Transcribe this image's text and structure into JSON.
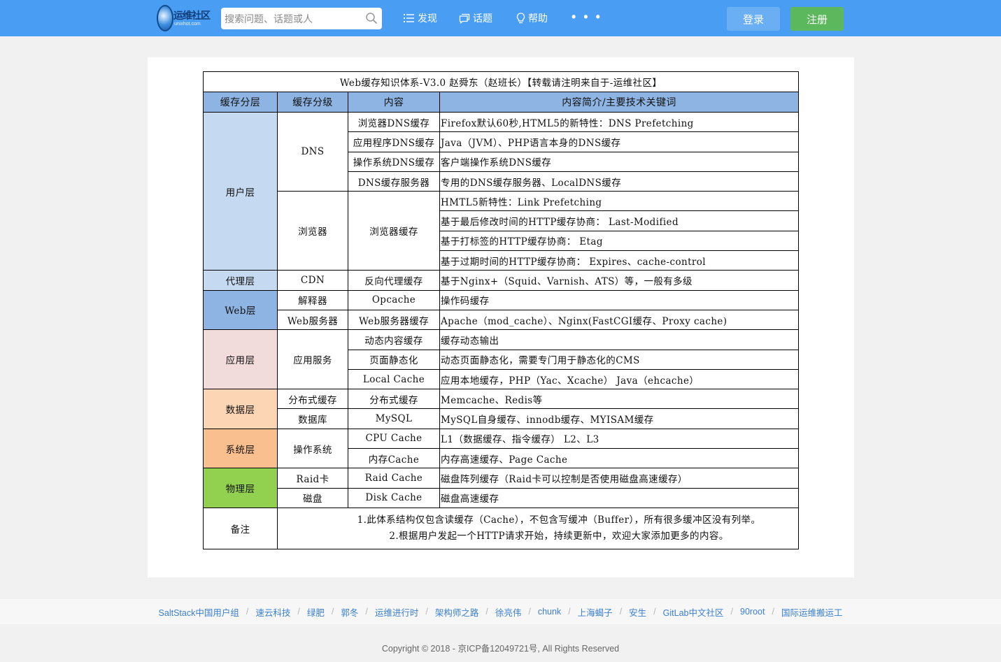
{
  "header": {
    "logo_text": "运维社区",
    "logo_sub": "unixhot.com",
    "search_placeholder": "搜索问题、话题或人",
    "nav": [
      {
        "label": "发现",
        "icon": "list-icon"
      },
      {
        "label": "话题",
        "icon": "chat-icon"
      },
      {
        "label": "帮助",
        "icon": "lightbulb-icon"
      }
    ],
    "more": "• • •",
    "login_label": "登录",
    "register_label": "注册"
  },
  "table": {
    "title": "Web缓存知识体系-V3.0 赵舜东（赵班长）【转载请注明来自于-运维社区】",
    "headers": [
      "缓存分层",
      "缓存分级",
      "内容",
      "内容简介/主要技术关键词"
    ],
    "user_layer": {
      "layer": "用户层",
      "dns": {
        "level": "DNS",
        "rows": [
          {
            "content": "浏览器DNS缓存",
            "desc": "Firefox默认60秒,HTML5的新特性：DNS Prefetching"
          },
          {
            "content": "应用程序DNS缓存",
            "desc": "Java（JVM）、PHP语言本身的DNS缓存"
          },
          {
            "content": "操作系统DNS缓存",
            "desc": "客户端操作系统DNS缓存"
          },
          {
            "content": "DNS缓存服务器",
            "desc": "专用的DNS缓存服务器、LocalDNS缓存"
          }
        ]
      },
      "browser": {
        "level": "浏览器",
        "content": "浏览器缓存",
        "descs": [
          "HMTL5新特性：Link Prefetching",
          "基于最后修改时间的HTTP缓存协商： Last-Modified",
          "基于打标签的HTTP缓存协商： Etag",
          "基于过期时间的HTTP缓存协商：  Expires、cache-control"
        ]
      }
    },
    "proxy_layer": {
      "layer": "代理层",
      "level": "CDN",
      "content": "反向代理缓存",
      "desc": "基于Nginx+（Squid、Varnish、ATS）等，一般有多级"
    },
    "web_layer": {
      "layer": "Web层",
      "rows": [
        {
          "level": "解释器",
          "content": "Opcache",
          "desc": "操作码缓存"
        },
        {
          "level": "Web服务器",
          "content": "Web服务器缓存",
          "desc": "Apache（mod_cache）、Nginx(FastCGI缓存、Proxy cache)"
        }
      ]
    },
    "app_layer": {
      "layer": "应用层",
      "level": "应用服务",
      "rows": [
        {
          "content": "动态内容缓存",
          "desc": "缓存动态输出"
        },
        {
          "content": "页面静态化",
          "desc": "动态页面静态化，需要专门用于静态化的CMS"
        },
        {
          "content": "Local Cache",
          "desc": "应用本地缓存，PHP（Yac、Xcache） Java（ehcache）"
        }
      ]
    },
    "data_layer": {
      "layer": "数据层",
      "rows": [
        {
          "level": "分布式缓存",
          "content": "分布式缓存",
          "desc": "Memcache、Redis等"
        },
        {
          "level": "数据库",
          "content": "MySQL",
          "desc": "MySQL自身缓存、innodb缓存、MYISAM缓存"
        }
      ]
    },
    "sys_layer": {
      "layer": "系统层",
      "level": "操作系统",
      "rows": [
        {
          "content": "CPU Cache",
          "desc": "L1（数据缓存、指令缓存） L2、L3"
        },
        {
          "content": "内存Cache",
          "desc": "内存高速缓存、Page Cache"
        }
      ]
    },
    "phys_layer": {
      "layer": "物理层",
      "rows": [
        {
          "level": "Raid卡",
          "content": "Raid Cache",
          "desc": "磁盘阵列缓存（Raid卡可以控制是否使用磁盘高速缓存）"
        },
        {
          "level": "磁盘",
          "content": "Disk Cache",
          "desc": "磁盘高速缓存"
        }
      ]
    },
    "note": {
      "label": "备注",
      "lines": [
        "1.此体系结构仅包含读缓存（Cache），不包含写缓冲（Buffer），所有很多缓冲区没有列举。",
        "2.根据用户发起一个HTTP请求开始，持续更新中，欢迎大家添加更多的内容。"
      ]
    }
  },
  "footer": {
    "links": [
      "SaltStack中国用户组",
      "速云科技",
      "绿肥",
      "郭冬",
      "运维进行时",
      "架构师之路",
      "徐亮伟",
      "chunk",
      "上海蝎子",
      "安生",
      "GitLab中文社区",
      "90root",
      "国际运维搬运工"
    ],
    "copyright": "Copyright © 2018 - 京ICP备12049721号, All Rights Reserved"
  },
  "colors": {
    "topbar": "#499ef3",
    "header_row": "#8db4e2",
    "user_layer": "#c5d9f1",
    "web_layer": "#8db4e2",
    "app_layer": "#f2dcdb",
    "data_layer": "#fcd5b4",
    "sys_layer": "#fabf8f",
    "phys_layer": "#92d050",
    "link": "#3b7fd0",
    "register": "#5cb85c"
  }
}
